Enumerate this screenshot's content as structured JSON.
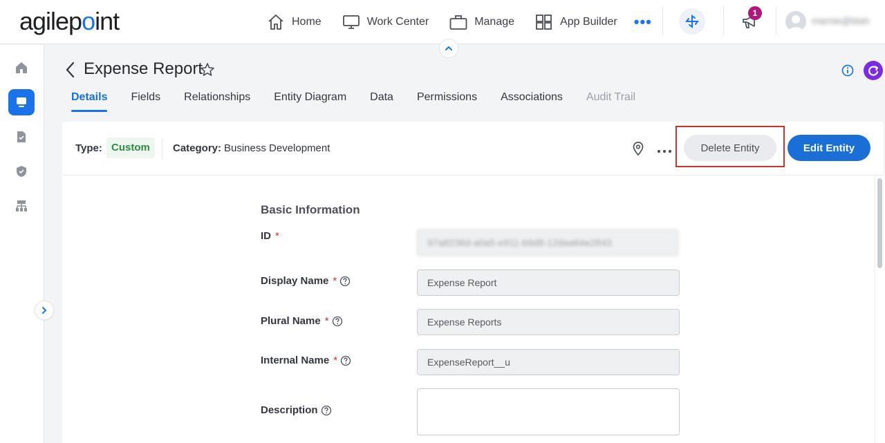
{
  "brand": {
    "logo_left": "agilep",
    "logo_dot": "o",
    "logo_right": "int"
  },
  "nav": {
    "items": [
      {
        "label": "Home",
        "icon": "home-icon"
      },
      {
        "label": "Work Center",
        "icon": "monitor-icon"
      },
      {
        "label": "Manage",
        "icon": "briefcase-icon"
      },
      {
        "label": "App Builder",
        "icon": "grid-icon"
      }
    ],
    "more": "•••"
  },
  "notifications": {
    "count": "1"
  },
  "user": {
    "name": "marnie@blah"
  },
  "page": {
    "title": "Expense Report",
    "tabs": [
      {
        "label": "Details",
        "state": "active"
      },
      {
        "label": "Fields",
        "state": "normal"
      },
      {
        "label": "Relationships",
        "state": "normal"
      },
      {
        "label": "Entity Diagram",
        "state": "normal"
      },
      {
        "label": "Data",
        "state": "normal"
      },
      {
        "label": "Permissions",
        "state": "normal"
      },
      {
        "label": "Associations",
        "state": "normal"
      },
      {
        "label": "Audit Trail",
        "state": "disabled"
      }
    ]
  },
  "entity": {
    "type_label": "Type:",
    "type_value": "Custom",
    "category_label": "Category:",
    "category_value": "Business Development",
    "delete_label": "Delete Entity",
    "edit_label": "Edit Entity"
  },
  "form": {
    "section_title": "Basic Information",
    "required_mark": "*",
    "fields": {
      "id": {
        "label": "ID",
        "value": "97a8236d-a0a5-e911-b9d8-12daa64e2643"
      },
      "display_name": {
        "label": "Display Name",
        "value": "Expense Report"
      },
      "plural_name": {
        "label": "Plural Name",
        "value": "Expense Reports"
      },
      "internal_name": {
        "label": "Internal Name",
        "value": "ExpenseReport__u"
      },
      "description": {
        "label": "Description",
        "value": ""
      }
    }
  },
  "colors": {
    "accent": "#1a73e8",
    "highlight": "#d32f2f",
    "badge": "#b0177a",
    "chip_text": "#2e8b3e"
  }
}
